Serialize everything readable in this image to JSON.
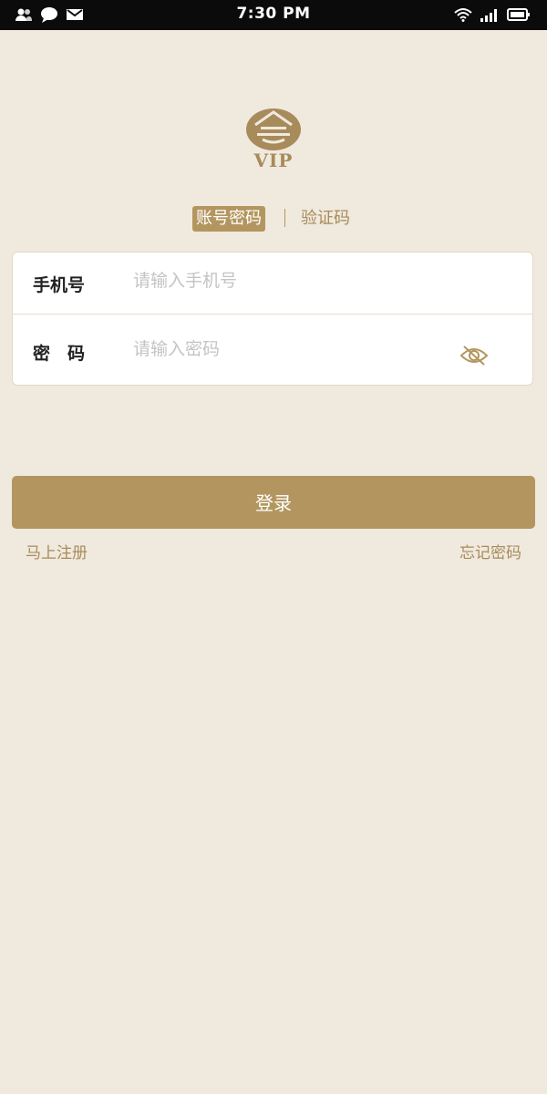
{
  "status_bar": {
    "time": "7:30 PM"
  },
  "logo": {
    "text": "VIP"
  },
  "tabs": {
    "active": "账号密码",
    "inactive": "验证码"
  },
  "form": {
    "phone_label": "手机号",
    "phone_placeholder": "请输入手机号",
    "password_label": "密　码",
    "password_placeholder": "请输入密码"
  },
  "actions": {
    "login_label": "登录",
    "register_label": "马上注册",
    "forgot_label": "忘记密码"
  },
  "colors": {
    "background": "#f0e9de",
    "accent": "#b3965f",
    "status_bar": "#0b0b0b"
  },
  "icons": [
    "contacts-icon",
    "chat-icon",
    "mail-icon",
    "wifi-icon",
    "signal-icon",
    "battery-icon",
    "eye-off-icon",
    "logo-emblem"
  ]
}
